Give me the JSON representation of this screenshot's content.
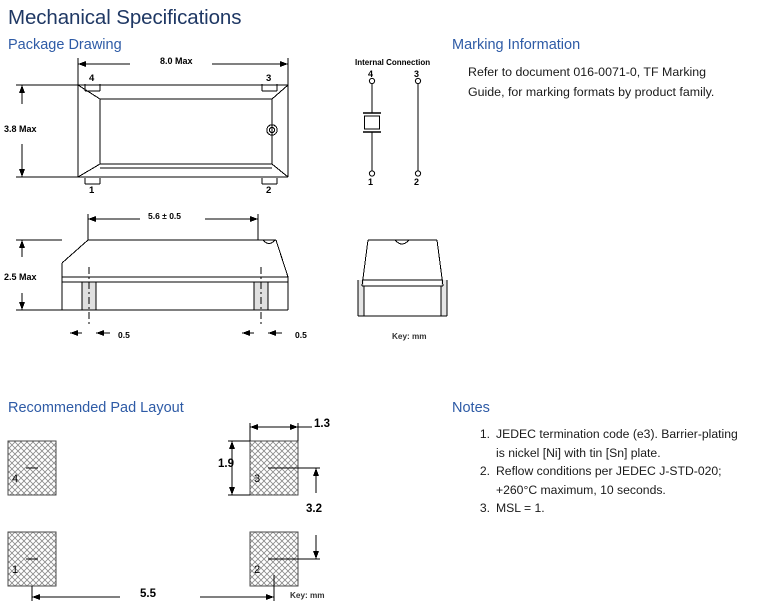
{
  "page": {
    "title": "Mechanical Specifications"
  },
  "sections": {
    "package_drawing": {
      "heading": "Package Drawing",
      "top_view": {
        "width_dim": "8.0 Max",
        "height_dim": "3.8 Max",
        "pin_labels": {
          "top_left": "4",
          "top_right": "3",
          "bottom_left": "1",
          "bottom_right": "2"
        },
        "pin1_marker": "pin-1-dot"
      },
      "side_view": {
        "length_dim": "5.6 ± 0.5",
        "height_dim": "2.5 Max",
        "lead_dim_left": "0.5",
        "lead_dim_right": "0.5"
      },
      "end_view": {
        "key": "Key:  mm"
      },
      "internal_connection": {
        "title": "Internal Connection",
        "pins": {
          "top_left": "4",
          "top_right": "3",
          "bottom_left": "1",
          "bottom_right": "2"
        },
        "element": "crystal-symbol"
      }
    },
    "marking_information": {
      "heading": "Marking Information",
      "body": "Refer to document 016-0071-0, TF Marking Guide, for marking formats by product family."
    },
    "pad_layout": {
      "heading": "Recommended Pad Layout",
      "pads": [
        {
          "label": "4",
          "position": "top-left"
        },
        {
          "label": "3",
          "position": "top-right"
        },
        {
          "label": "1",
          "position": "bottom-left"
        },
        {
          "label": "2",
          "position": "bottom-right"
        }
      ],
      "dims": {
        "pad_width": "1.3",
        "pad_height": "1.9",
        "vertical_pitch": "3.2",
        "horizontal_pitch": "5.5"
      },
      "key": "Key:  mm"
    },
    "notes": {
      "heading": "Notes",
      "items": [
        {
          "num": "1.",
          "text": "JEDEC termination code (e3).  Barrier-plating is nickel [Ni] with tin [Sn] plate."
        },
        {
          "num": "2.",
          "text": "Reflow conditions per JEDEC J-STD-020; +260°C maximum, 10 seconds."
        },
        {
          "num": "3.",
          "text": "MSL = 1."
        }
      ]
    }
  },
  "colors": {
    "title": "#1F3864",
    "subheading": "#2E5BA6",
    "line": "#000000",
    "body": "#1a1a1a"
  }
}
